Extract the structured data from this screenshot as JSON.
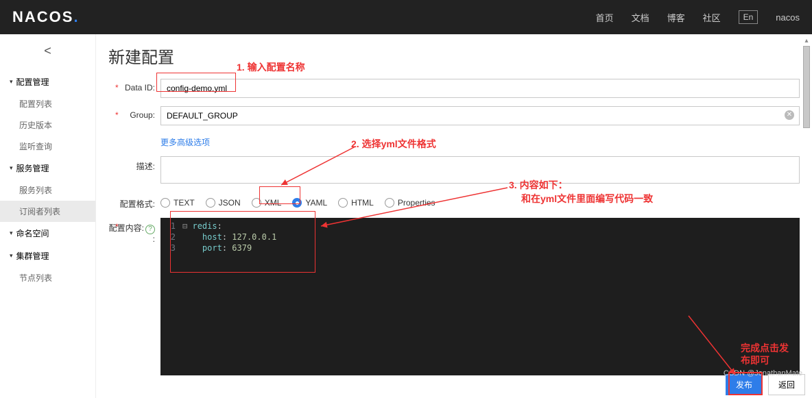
{
  "header": {
    "logo_text": "NACOS",
    "nav": {
      "home": "首页",
      "docs": "文档",
      "blog": "博客",
      "community": "社区",
      "lang": "En",
      "user": "nacos"
    }
  },
  "sidebar": {
    "groups": [
      {
        "title": "配置管理",
        "items": [
          "配置列表",
          "历史版本",
          "监听查询"
        ]
      },
      {
        "title": "服务管理",
        "items": [
          "服务列表",
          "订阅者列表"
        ]
      },
      {
        "title": "命名空间",
        "items": []
      },
      {
        "title": "集群管理",
        "items": [
          "节点列表"
        ]
      }
    ],
    "active_item": "订阅者列表"
  },
  "page": {
    "title": "新建配置",
    "labels": {
      "data_id": "Data ID:",
      "group": "Group:",
      "adv": "更多高级选项",
      "desc": "描述:",
      "format": "配置格式:",
      "content": "配置内容:"
    },
    "values": {
      "data_id": "config-demo.yml",
      "group": "DEFAULT_GROUP",
      "desc": ""
    },
    "formats": [
      "TEXT",
      "JSON",
      "XML",
      "YAML",
      "HTML",
      "Properties"
    ],
    "selected_format": "YAML",
    "editor_lines": [
      "1",
      "2",
      "3"
    ],
    "buttons": {
      "publish": "发布",
      "back": "返回"
    }
  },
  "annotations": {
    "a1": "1. 输入配置名称",
    "a2": "2. 选择yml文件格式",
    "a3_l1": "3. 内容如下：",
    "a3_l2": "和在yml文件里面编写代码一致",
    "a4_l1": "完成点击发",
    "a4_l2": "布即可"
  },
  "watermark": "CSDN @JonathanMate"
}
